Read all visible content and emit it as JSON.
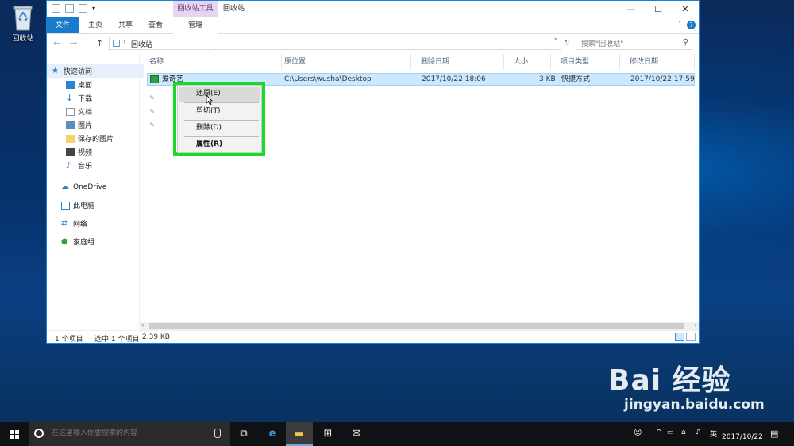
{
  "desktop": {
    "recycle_bin_label": "回收站",
    "watermark_brand": "Bai 经验",
    "watermark_site": "jingyan.baidu.com"
  },
  "window": {
    "context_tab_label": "回收站工具",
    "title": "回收站",
    "controls": {
      "minimize": "—",
      "maximize": "☐",
      "close": "✕"
    },
    "ribbon_tabs": {
      "file": "文件",
      "home": "主页",
      "share": "共享",
      "view": "查看",
      "manage": "管理"
    },
    "help": "?"
  },
  "address": {
    "location": "回收站",
    "search_placeholder": "搜索\"回收站\""
  },
  "nav": {
    "quick_access": "快速访问",
    "desktop": "桌面",
    "downloads": "下载",
    "documents": "文档",
    "pictures": "图片",
    "saved_pictures": "保存的图片",
    "videos": "视频",
    "music": "音乐",
    "onedrive": "OneDrive",
    "this_pc": "此电脑",
    "network": "网络",
    "homegroup": "家庭组"
  },
  "columns": {
    "name": "名称",
    "original_location": "原位置",
    "date_deleted": "删除日期",
    "size": "大小",
    "item_type": "项目类型",
    "date_modified": "修改日期"
  },
  "file_row": {
    "name": "爱奇艺",
    "original_location": "C:\\Users\\wusha\\Desktop",
    "date_deleted": "2017/10/22 18:06",
    "size": "3 KB",
    "item_type": "快捷方式",
    "date_modified": "2017/10/22 17:59"
  },
  "context_menu": {
    "restore": "还原(E)",
    "cut": "剪切(T)",
    "delete": "删除(D)",
    "properties": "属性(R)"
  },
  "status": {
    "item_count": "1 个项目",
    "selected": "选中 1 个项目",
    "size": "2.39 KB"
  },
  "taskbar": {
    "search_placeholder": "在这里输入你要搜索的内容",
    "ime": "英",
    "date": "2017/10/22"
  },
  "colors": {
    "accent": "#1979ca",
    "highlight_box": "#19d929",
    "selected_row": "#cce8ff",
    "context_tool_tab": "#e8d4ef"
  }
}
